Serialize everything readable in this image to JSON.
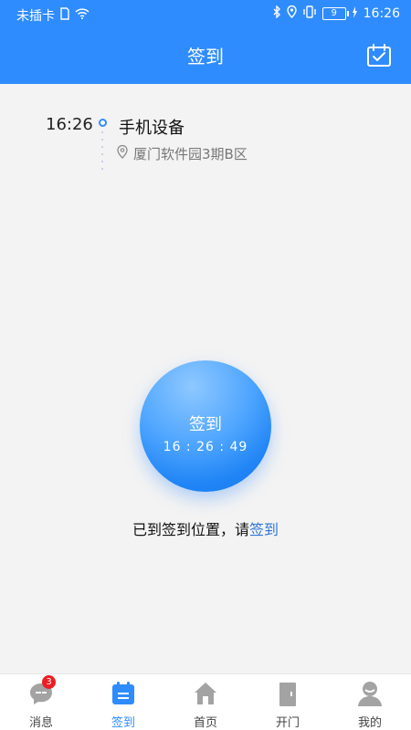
{
  "status_bar": {
    "carrier": "未插卡",
    "battery": "9",
    "time": "16:26"
  },
  "header": {
    "title": "签到",
    "calendar_icon": "calendar-check-icon"
  },
  "record": {
    "time": "16:26",
    "device": "手机设备",
    "location": "厦门软件园3期B区"
  },
  "sign": {
    "label": "签到",
    "clock": "16 : 26 : 49"
  },
  "status_message": {
    "prefix": "已到签到位置，请",
    "link": "签到"
  },
  "tabs": [
    {
      "label": "消息",
      "badge": "3",
      "icon": "message-icon",
      "active": false
    },
    {
      "label": "签到",
      "icon": "checkin-calendar-icon",
      "active": true
    },
    {
      "label": "首页",
      "icon": "home-icon",
      "active": false
    },
    {
      "label": "开门",
      "icon": "door-icon",
      "active": false
    },
    {
      "label": "我的",
      "icon": "profile-icon",
      "active": false
    }
  ],
  "colors": {
    "primary": "#2f8cff",
    "background": "#f3f3f3",
    "badge": "#ef1c24"
  }
}
